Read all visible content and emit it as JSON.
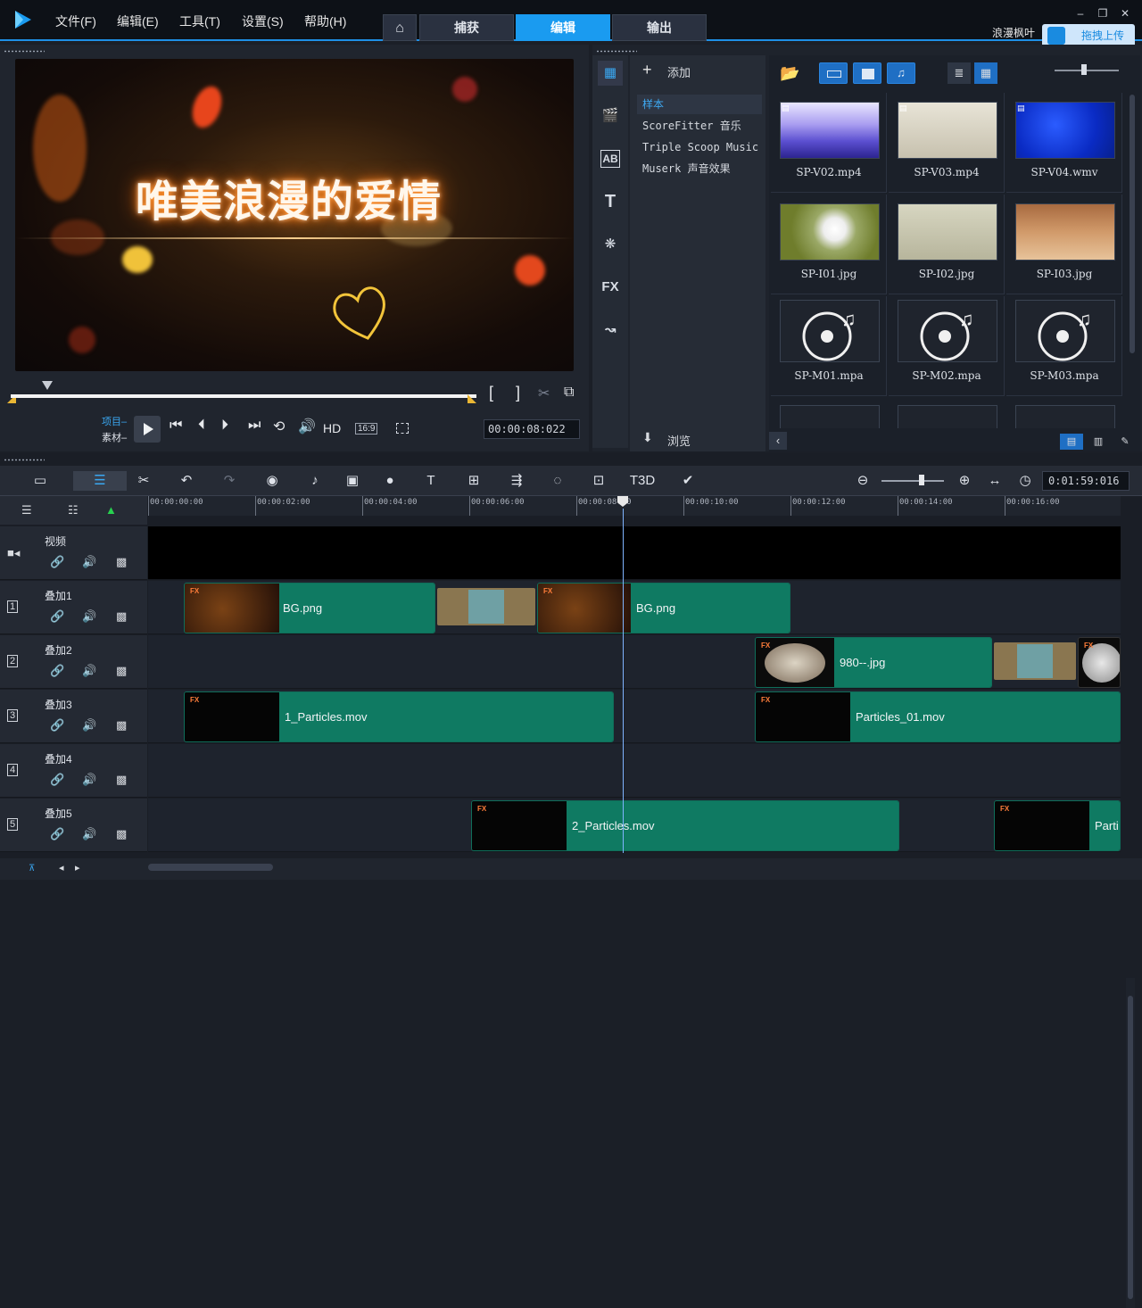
{
  "menu": {
    "file": "文件(F)",
    "edit": "编辑(E)",
    "tools": "工具(T)",
    "settings": "设置(S)",
    "help": "帮助(H)"
  },
  "tabs": {
    "capture": "捕获",
    "edit": "编辑",
    "output": "输出"
  },
  "user": {
    "name": "浪漫枫叶",
    "upload": "拖拽上传"
  },
  "preview": {
    "title": "唯美浪漫的爱情"
  },
  "player": {
    "project_label": "项目–",
    "clip_label": "素材–",
    "hd": "HD",
    "aspect": "16:9",
    "timecode": "00:00:08:022",
    "bracket_in": "[",
    "bracket_out": "]"
  },
  "library": {
    "add_label": "添加",
    "categories": [
      "样本",
      "ScoreFitter 音乐",
      "Triple Scoop Music",
      "Muserk 声音效果"
    ],
    "browse_label": "浏览",
    "items": [
      {
        "name": "SP-V02.mp4",
        "kind": "video"
      },
      {
        "name": "SP-V03.mp4",
        "kind": "video"
      },
      {
        "name": "SP-V04.wmv",
        "kind": "video"
      },
      {
        "name": "SP-I01.jpg",
        "kind": "image"
      },
      {
        "name": "SP-I02.jpg",
        "kind": "image"
      },
      {
        "name": "SP-I03.jpg",
        "kind": "image"
      },
      {
        "name": "SP-M01.mpa",
        "kind": "audio"
      },
      {
        "name": "SP-M02.mpa",
        "kind": "audio"
      },
      {
        "name": "SP-M03.mpa",
        "kind": "audio"
      }
    ]
  },
  "timeline": {
    "total_time": "0:01:59:016",
    "ruler": [
      "00:00:00:00",
      "00:00:02:00",
      "00:00:04:00",
      "00:00:06:00",
      "00:00:08:00",
      "00:00:10:00",
      "00:00:12:00",
      "00:00:14:00",
      "00:00:16:00"
    ],
    "tracks": [
      {
        "name": "视频",
        "index": ""
      },
      {
        "name": "叠加1",
        "index": "1"
      },
      {
        "name": "叠加2",
        "index": "2"
      },
      {
        "name": "叠加3",
        "index": "3"
      },
      {
        "name": "叠加4",
        "index": "4"
      },
      {
        "name": "叠加5",
        "index": "5"
      }
    ],
    "clips": {
      "o1a": "BG.png",
      "o1b": "BG.png",
      "o2a": "980--.jpg",
      "o3a": "1_Particles.mov",
      "o3b": "Particles_01.mov",
      "o5a": "2_Particles.mov",
      "o5b": "Parti"
    },
    "fx": "FX"
  },
  "colors": {
    "accent": "#1a9bf0",
    "clip": "#0f7a62",
    "bg": "#1a1e26"
  }
}
